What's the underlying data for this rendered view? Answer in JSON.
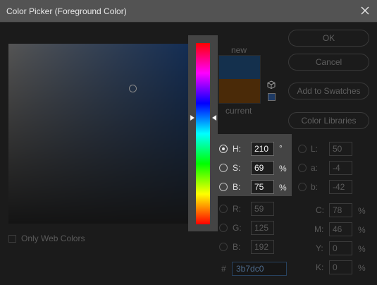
{
  "window": {
    "title": "Color Picker (Foreground Color)"
  },
  "preview": {
    "new_label": "new",
    "current_label": "current",
    "new_color": "#14304d",
    "current_color": "#4a2a08"
  },
  "buttons": {
    "ok": "OK",
    "cancel": "Cancel",
    "add_swatches": "Add to Swatches",
    "color_libraries": "Color Libraries"
  },
  "hsb": {
    "h": {
      "label": "H:",
      "value": "210",
      "unit": "°"
    },
    "s": {
      "label": "S:",
      "value": "69",
      "unit": "%"
    },
    "b": {
      "label": "B:",
      "value": "75",
      "unit": "%"
    }
  },
  "lab": {
    "l": {
      "label": "L:",
      "value": "50"
    },
    "a": {
      "label": "a:",
      "value": "-4"
    },
    "b": {
      "label": "b:",
      "value": "-42"
    }
  },
  "rgb": {
    "r": {
      "label": "R:",
      "value": "59"
    },
    "g": {
      "label": "G:",
      "value": "125"
    },
    "b": {
      "label": "B:",
      "value": "192"
    }
  },
  "cmyk": {
    "c": {
      "label": "C:",
      "value": "78",
      "unit": "%"
    },
    "m": {
      "label": "M:",
      "value": "46",
      "unit": "%"
    },
    "y": {
      "label": "Y:",
      "value": "0",
      "unit": "%"
    },
    "k": {
      "label": "K:",
      "value": "0",
      "unit": "%"
    }
  },
  "hex": {
    "label": "#",
    "value": "3b7dc0"
  },
  "web_colors": {
    "label": "Only Web Colors",
    "checked": false
  },
  "icons": [
    "close-icon",
    "cube-icon",
    "hue-slider-arrow-icon"
  ]
}
